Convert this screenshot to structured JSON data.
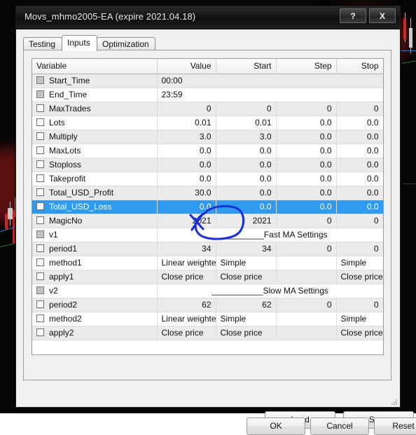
{
  "window": {
    "title": "Movs_mhmo2005-EA (expire 2021.04.18)",
    "help_button": "?",
    "close_button": "X"
  },
  "tabs": [
    {
      "label": "Testing",
      "active": false
    },
    {
      "label": "Inputs",
      "active": true
    },
    {
      "label": "Optimization",
      "active": false
    }
  ],
  "table": {
    "columns": [
      "Variable",
      "Value",
      "Start",
      "Step",
      "Stop"
    ],
    "rows": [
      {
        "variable": "Start_Time",
        "checkbox": "disabled",
        "span": true,
        "value": "00:00",
        "start": "",
        "step": "",
        "stop": ""
      },
      {
        "variable": "End_Time",
        "checkbox": "disabled",
        "span": true,
        "value": "23:59",
        "start": "",
        "step": "",
        "stop": ""
      },
      {
        "variable": "MaxTrades",
        "checkbox": "empty",
        "align": "num",
        "value": "0",
        "start": "0",
        "step": "0",
        "stop": "0"
      },
      {
        "variable": "Lots",
        "checkbox": "empty",
        "align": "num",
        "value": "0.01",
        "start": "0.01",
        "step": "0.0",
        "stop": "0.0"
      },
      {
        "variable": "Multiply",
        "checkbox": "empty",
        "align": "num",
        "value": "3.0",
        "start": "3.0",
        "step": "0.0",
        "stop": "0.0"
      },
      {
        "variable": "MaxLots",
        "checkbox": "empty",
        "align": "num",
        "value": "0.0",
        "start": "0.0",
        "step": "0.0",
        "stop": "0.0"
      },
      {
        "variable": "Stoploss",
        "checkbox": "empty",
        "align": "num",
        "value": "0.0",
        "start": "0.0",
        "step": "0.0",
        "stop": "0.0"
      },
      {
        "variable": "Takeprofit",
        "checkbox": "empty",
        "align": "num",
        "value": "0.0",
        "start": "0.0",
        "step": "0.0",
        "stop": "0.0"
      },
      {
        "variable": "Total_USD_Profit",
        "checkbox": "empty",
        "align": "num",
        "value": "30.0",
        "start": "0.0",
        "step": "0.0",
        "stop": "0.0"
      },
      {
        "variable": "Total_USD_Loss",
        "checkbox": "empty",
        "align": "num",
        "value": "0.0",
        "start": "0.0",
        "step": "0.0",
        "stop": "0.0",
        "selected": true
      },
      {
        "variable": "MagicNo",
        "checkbox": "empty",
        "align": "num",
        "value": "2021",
        "start": "2021",
        "step": "0",
        "stop": "0"
      },
      {
        "variable": "v1",
        "checkbox": "disabled",
        "span": true,
        "separator": true,
        "value": "___________Fast MA Settings",
        "start": "",
        "step": "",
        "stop": ""
      },
      {
        "variable": "period1",
        "checkbox": "empty",
        "align": "num",
        "value": "34",
        "start": "34",
        "step": "0",
        "stop": "0"
      },
      {
        "variable": "method1",
        "checkbox": "empty",
        "align": "txt",
        "value": "Linear weighted",
        "start": "Simple",
        "step": "",
        "stop": "Simple"
      },
      {
        "variable": "apply1",
        "checkbox": "empty",
        "align": "txt",
        "value": "Close price",
        "start": "Close price",
        "step": "",
        "stop": "Close price"
      },
      {
        "variable": "v2",
        "checkbox": "disabled",
        "span": true,
        "separator": true,
        "value": "___________Slow MA Settings",
        "start": "",
        "step": "",
        "stop": ""
      },
      {
        "variable": "period2",
        "checkbox": "empty",
        "align": "num",
        "value": "62",
        "start": "62",
        "step": "0",
        "stop": "0"
      },
      {
        "variable": "method2",
        "checkbox": "empty",
        "align": "txt",
        "value": "Linear weighted",
        "start": "Simple",
        "step": "",
        "stop": "Simple"
      },
      {
        "variable": "apply2",
        "checkbox": "empty",
        "align": "txt",
        "value": "Close price",
        "start": "Close price",
        "step": "",
        "stop": "Close price"
      }
    ]
  },
  "buttons": {
    "load": "Load",
    "save": "Save",
    "ok": "OK",
    "cancel": "Cancel",
    "reset": "Reset"
  },
  "annotation": {
    "shape": "hand-drawn-ellipse-with-cross",
    "target_value": "30.0",
    "color": "#1a2fd4"
  },
  "colors": {
    "selection": "#2e9bf0",
    "row_alt": "#ebebeb",
    "window_bg": "#f0f0f0",
    "titlebar": "#141414"
  }
}
